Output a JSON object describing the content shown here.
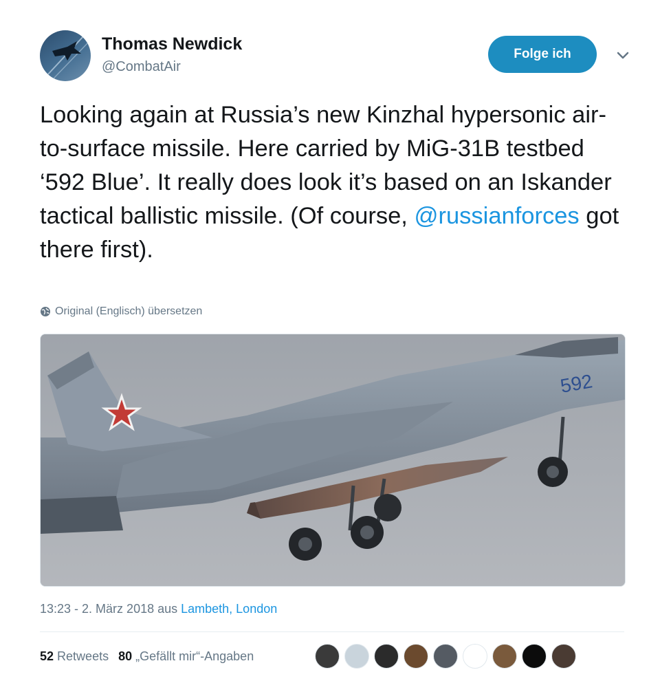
{
  "author": {
    "name": "Thomas Newdick",
    "handle": "@CombatAir",
    "follow_label": "Folge ich"
  },
  "icons": {
    "caret": "chevron-down-icon",
    "translate": "globe-icon"
  },
  "tweet": {
    "text_before_mention": "Looking again at Russia’s new Kinzhal hypersonic air-to-surface missile. Here carried by MiG-31B testbed ‘592 Blue’. It really does look it’s based on an Iskander tactical ballistic missile. (Of course, ",
    "mention": "@russianforces",
    "text_after_mention": " got there first).",
    "translate_label": "Original (Englisch) übersetzen",
    "media_tail_number": "592"
  },
  "meta": {
    "time_date": "13:23 - 2. März 2018 aus ",
    "location": "Lambeth, London"
  },
  "stats": {
    "retweets_count": "52",
    "retweets_label": "Retweets",
    "likes_count": "80",
    "likes_label": "„Gefällt mir“-Angaben"
  },
  "colors": {
    "accent": "#1d8dc0",
    "link": "#1b95e0",
    "muted": "#657786"
  },
  "liker_avatars": [
    {
      "color": "#3a3a3a"
    },
    {
      "color": "#c9d4dc"
    },
    {
      "color": "#2b2b2b"
    },
    {
      "color": "#6b4a2e"
    },
    {
      "color": "#555b63"
    },
    {
      "color": "#ffffff"
    },
    {
      "color": "#7a5a3c"
    },
    {
      "color": "#0c0c0c"
    },
    {
      "color": "#4a3b33"
    }
  ]
}
